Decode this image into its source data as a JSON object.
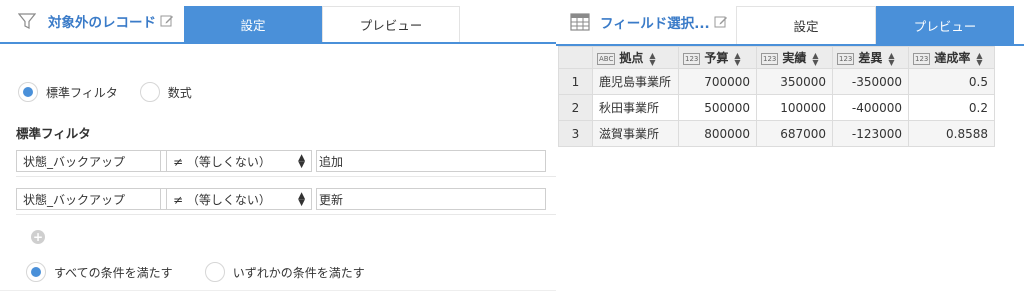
{
  "left_panel": {
    "title": "対象外のレコード",
    "tabs": {
      "settings": "設定",
      "preview": "プレビュー"
    },
    "filter_mode": {
      "options": [
        "標準フィルタ",
        "数式"
      ],
      "selected": "標準フィルタ"
    },
    "section_label": "標準フィルタ",
    "conditions": [
      {
        "field": "状態_バックアップ",
        "operator": "≠ （等しくない）",
        "value": "追加"
      },
      {
        "field": "状態_バックアップ",
        "operator": "≠ （等しくない）",
        "value": "更新"
      }
    ],
    "add_button": "+",
    "match_mode": {
      "options": [
        "すべての条件を満たす",
        "いずれかの条件を満たす"
      ],
      "selected": "すべての条件を満たす"
    }
  },
  "right_panel": {
    "title": "フィールド選択...",
    "tabs": {
      "settings": "設定",
      "preview": "プレビュー"
    },
    "columns": [
      {
        "type": "ABC",
        "name": "拠点"
      },
      {
        "type": "123",
        "name": "予算"
      },
      {
        "type": "123",
        "name": "実績"
      },
      {
        "type": "123",
        "name": "差異"
      },
      {
        "type": "123",
        "name": "達成率"
      }
    ],
    "rows": [
      {
        "index": "1",
        "cells": [
          "鹿児島事業所",
          "700000",
          "350000",
          "-350000",
          "0.5"
        ]
      },
      {
        "index": "2",
        "cells": [
          "秋田事業所",
          "500000",
          "100000",
          "-400000",
          "0.2"
        ]
      },
      {
        "index": "3",
        "cells": [
          "滋賀事業所",
          "800000",
          "687000",
          "-123000",
          "0.8588"
        ]
      }
    ]
  },
  "colors": {
    "accent": "#4a90d9",
    "title": "#3a7bc8"
  }
}
